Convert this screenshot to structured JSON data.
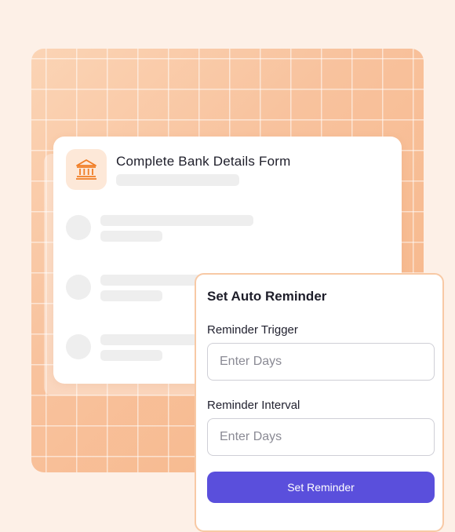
{
  "card": {
    "title": "Complete Bank Details Form",
    "icon": "bank-icon"
  },
  "reminder": {
    "title": "Set Auto Reminder",
    "trigger_label": "Reminder Trigger",
    "trigger_placeholder": "Enter Days",
    "interval_label": "Reminder Interval",
    "interval_placeholder": "Enter Days",
    "button_label": "Set Reminder"
  },
  "colors": {
    "accent": "#5a4fdc",
    "icon": "#f07c24",
    "background": "#fdf0e7",
    "panel": "#f8c29d"
  }
}
